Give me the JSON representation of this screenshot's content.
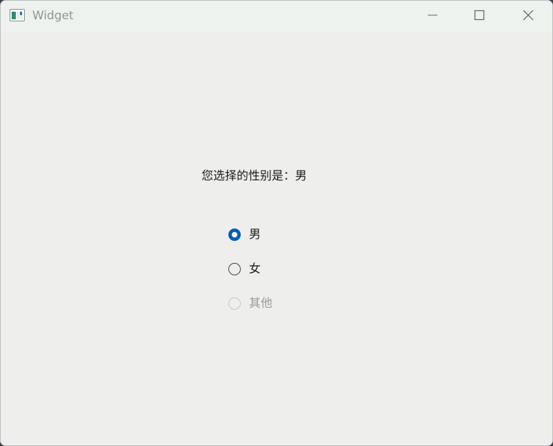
{
  "window": {
    "title": "Widget",
    "controls": {
      "minimize": "minimize",
      "maximize": "maximize",
      "close": "close"
    }
  },
  "content": {
    "status_text": "您选择的性别是：男",
    "radios": [
      {
        "label": "男",
        "checked": true,
        "enabled": true
      },
      {
        "label": "女",
        "checked": false,
        "enabled": true
      },
      {
        "label": "其他",
        "checked": false,
        "enabled": false
      }
    ]
  },
  "colors": {
    "accent": "#005fb8",
    "titlebar": "#eef2ef",
    "background": "#eeeeec"
  }
}
